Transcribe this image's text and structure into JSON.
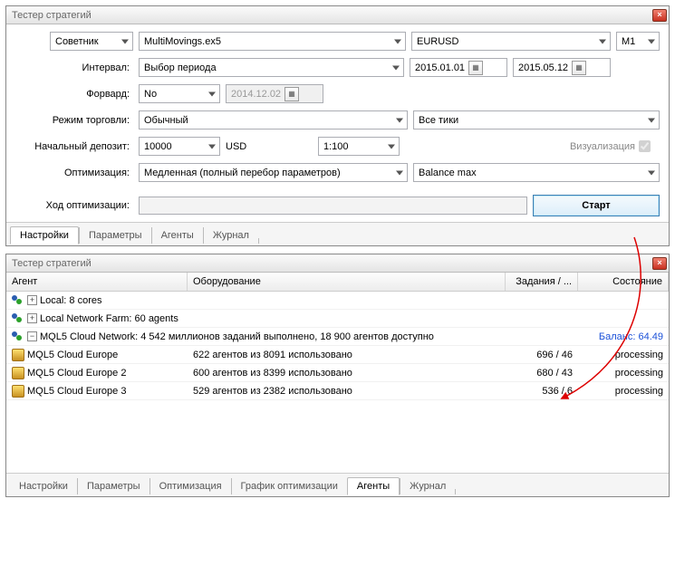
{
  "win1": {
    "title": "Тестер стратегий",
    "expert_label": "Советник",
    "expert_file": "MultiMovings.ex5",
    "symbol": "EURUSD",
    "tf": "M1",
    "interval_label": "Интервал:",
    "interval_value": "Выбор периода",
    "date_from": "2015.01.01",
    "date_to": "2015.05.12",
    "forward_label": "Форвард:",
    "forward_value": "No",
    "forward_date": "2014.12.02",
    "mode_label": "Режим торговли:",
    "mode_value": "Обычный",
    "ticks_value": "Все тики",
    "deposit_label": "Начальный депозит:",
    "deposit_value": "10000",
    "deposit_ccy": "USD",
    "leverage": "1:100",
    "vis_label": "Визуализация",
    "opt_label": "Оптимизация:",
    "opt_value": "Медленная (полный перебор параметров)",
    "opt_crit": "Balance max",
    "progress_label": "Ход оптимизации:",
    "start": "Старт",
    "tabs": [
      "Настройки",
      "Параметры",
      "Агенты",
      "Журнал"
    ]
  },
  "win2": {
    "title": "Тестер стратегий",
    "cols": {
      "agent": "Агент",
      "equip": "Оборудование",
      "task": "Задания / ...",
      "state": "Состояние"
    },
    "local": {
      "toggle": "+",
      "text": "Local: 8 cores"
    },
    "farm": {
      "toggle": "+",
      "text": "Local Network Farm: 60 agents"
    },
    "cloud": {
      "toggle": "−",
      "text": "MQL5 Cloud Network: 4 542 миллионов заданий выполнено, 18 900 агентов доступно",
      "balance": "Баланс: 64.49"
    },
    "rows": [
      {
        "name": "MQL5 Cloud Europe",
        "equip": "622 агентов из 8091 использовано",
        "task": "696 / 46",
        "state": "processing"
      },
      {
        "name": "MQL5 Cloud Europe 2",
        "equip": "600 агентов из 8399 использовано",
        "task": "680 / 43",
        "state": "processing"
      },
      {
        "name": "MQL5 Cloud Europe 3",
        "equip": "529 агентов из 2382 использовано",
        "task": "536 / 6",
        "state": "processing"
      }
    ],
    "tabs": [
      "Настройки",
      "Параметры",
      "Оптимизация",
      "График оптимизации",
      "Агенты",
      "Журнал"
    ]
  }
}
